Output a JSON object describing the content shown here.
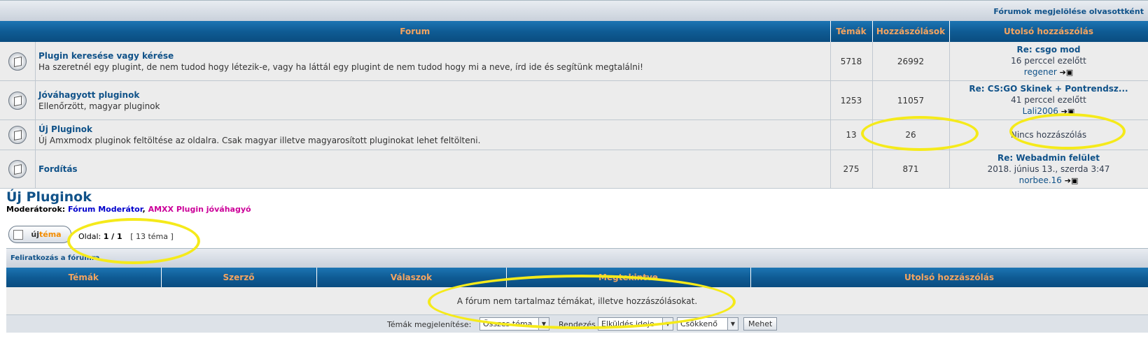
{
  "topbar": {
    "mark_read": "Fórumok megjelölése olvasottként"
  },
  "forum_table": {
    "headers": [
      "Forum",
      "Témák",
      "Hozzászólások",
      "Utolsó hozzászólás"
    ],
    "rows": [
      {
        "title": "Plugin keresése vagy kérése",
        "desc": "Ha szeretnél egy plugint, de nem tudod hogy létezik-e, vagy ha láttál egy plugint de nem tudod hogy mi a neve, írd ide és segítünk megtalálni!",
        "topics": "5718",
        "posts": "26992",
        "last_title": "Re: csgo mod",
        "last_time": "16 perccel ezelőtt",
        "last_user": "regener"
      },
      {
        "title": "Jóváhagyott pluginok",
        "desc": "Ellenőrzött, magyar pluginok",
        "topics": "1253",
        "posts": "11057",
        "last_title": "Re: CS:GO Skinek + Pontrendsz...",
        "last_time": "41 perccel ezelőtt",
        "last_user": "Lali2006"
      },
      {
        "title": "Új Pluginok",
        "desc": "Új Amxmodx pluginok feltöltése az oldalra. Csak magyar illetve magyarosított pluginokat lehet feltölteni.",
        "topics": "13",
        "posts": "26",
        "last_none": "Nincs hozzászólás"
      },
      {
        "title": "Fordítás",
        "desc": "",
        "topics": "275",
        "posts": "871",
        "last_title": "Re: Webadmin felület",
        "last_time": "2018. június 13., szerda 3:47",
        "last_user": "norbee.16"
      }
    ]
  },
  "section": {
    "title": "Új Pluginok",
    "mods_label": "Moderátorok:",
    "mod1": "Fórum Moderátor",
    "mod_sep": ",",
    "mod2": "AMXX Plugin jóváhagyó"
  },
  "newtopic": {
    "part1": "új",
    "part2": "téma"
  },
  "pager": {
    "label": "Oldal:",
    "value": "1 / 1",
    "count": "[ 13 téma ]"
  },
  "subscribe": "Feliratkozás a fórumra",
  "topic_table": {
    "headers": [
      "Témák",
      "Szerző",
      "Válaszok",
      "Megtekintve",
      "Utolsó hozzászólás"
    ],
    "empty": "A fórum nem tartalmaz témákat, illetve hozzászólásokat."
  },
  "filters": {
    "display_label": "Témák megjelenítése:",
    "display_value": "Összes téma",
    "sort_label": "Rendezés",
    "sort_value": "Elküldés ideje",
    "order_value": "Csökkenő",
    "go": "Mehet"
  },
  "colors": {
    "header_blue": "#0f5b94",
    "header_text": "#f4a460",
    "link": "#105289",
    "highlight": "#f5ea1a"
  }
}
